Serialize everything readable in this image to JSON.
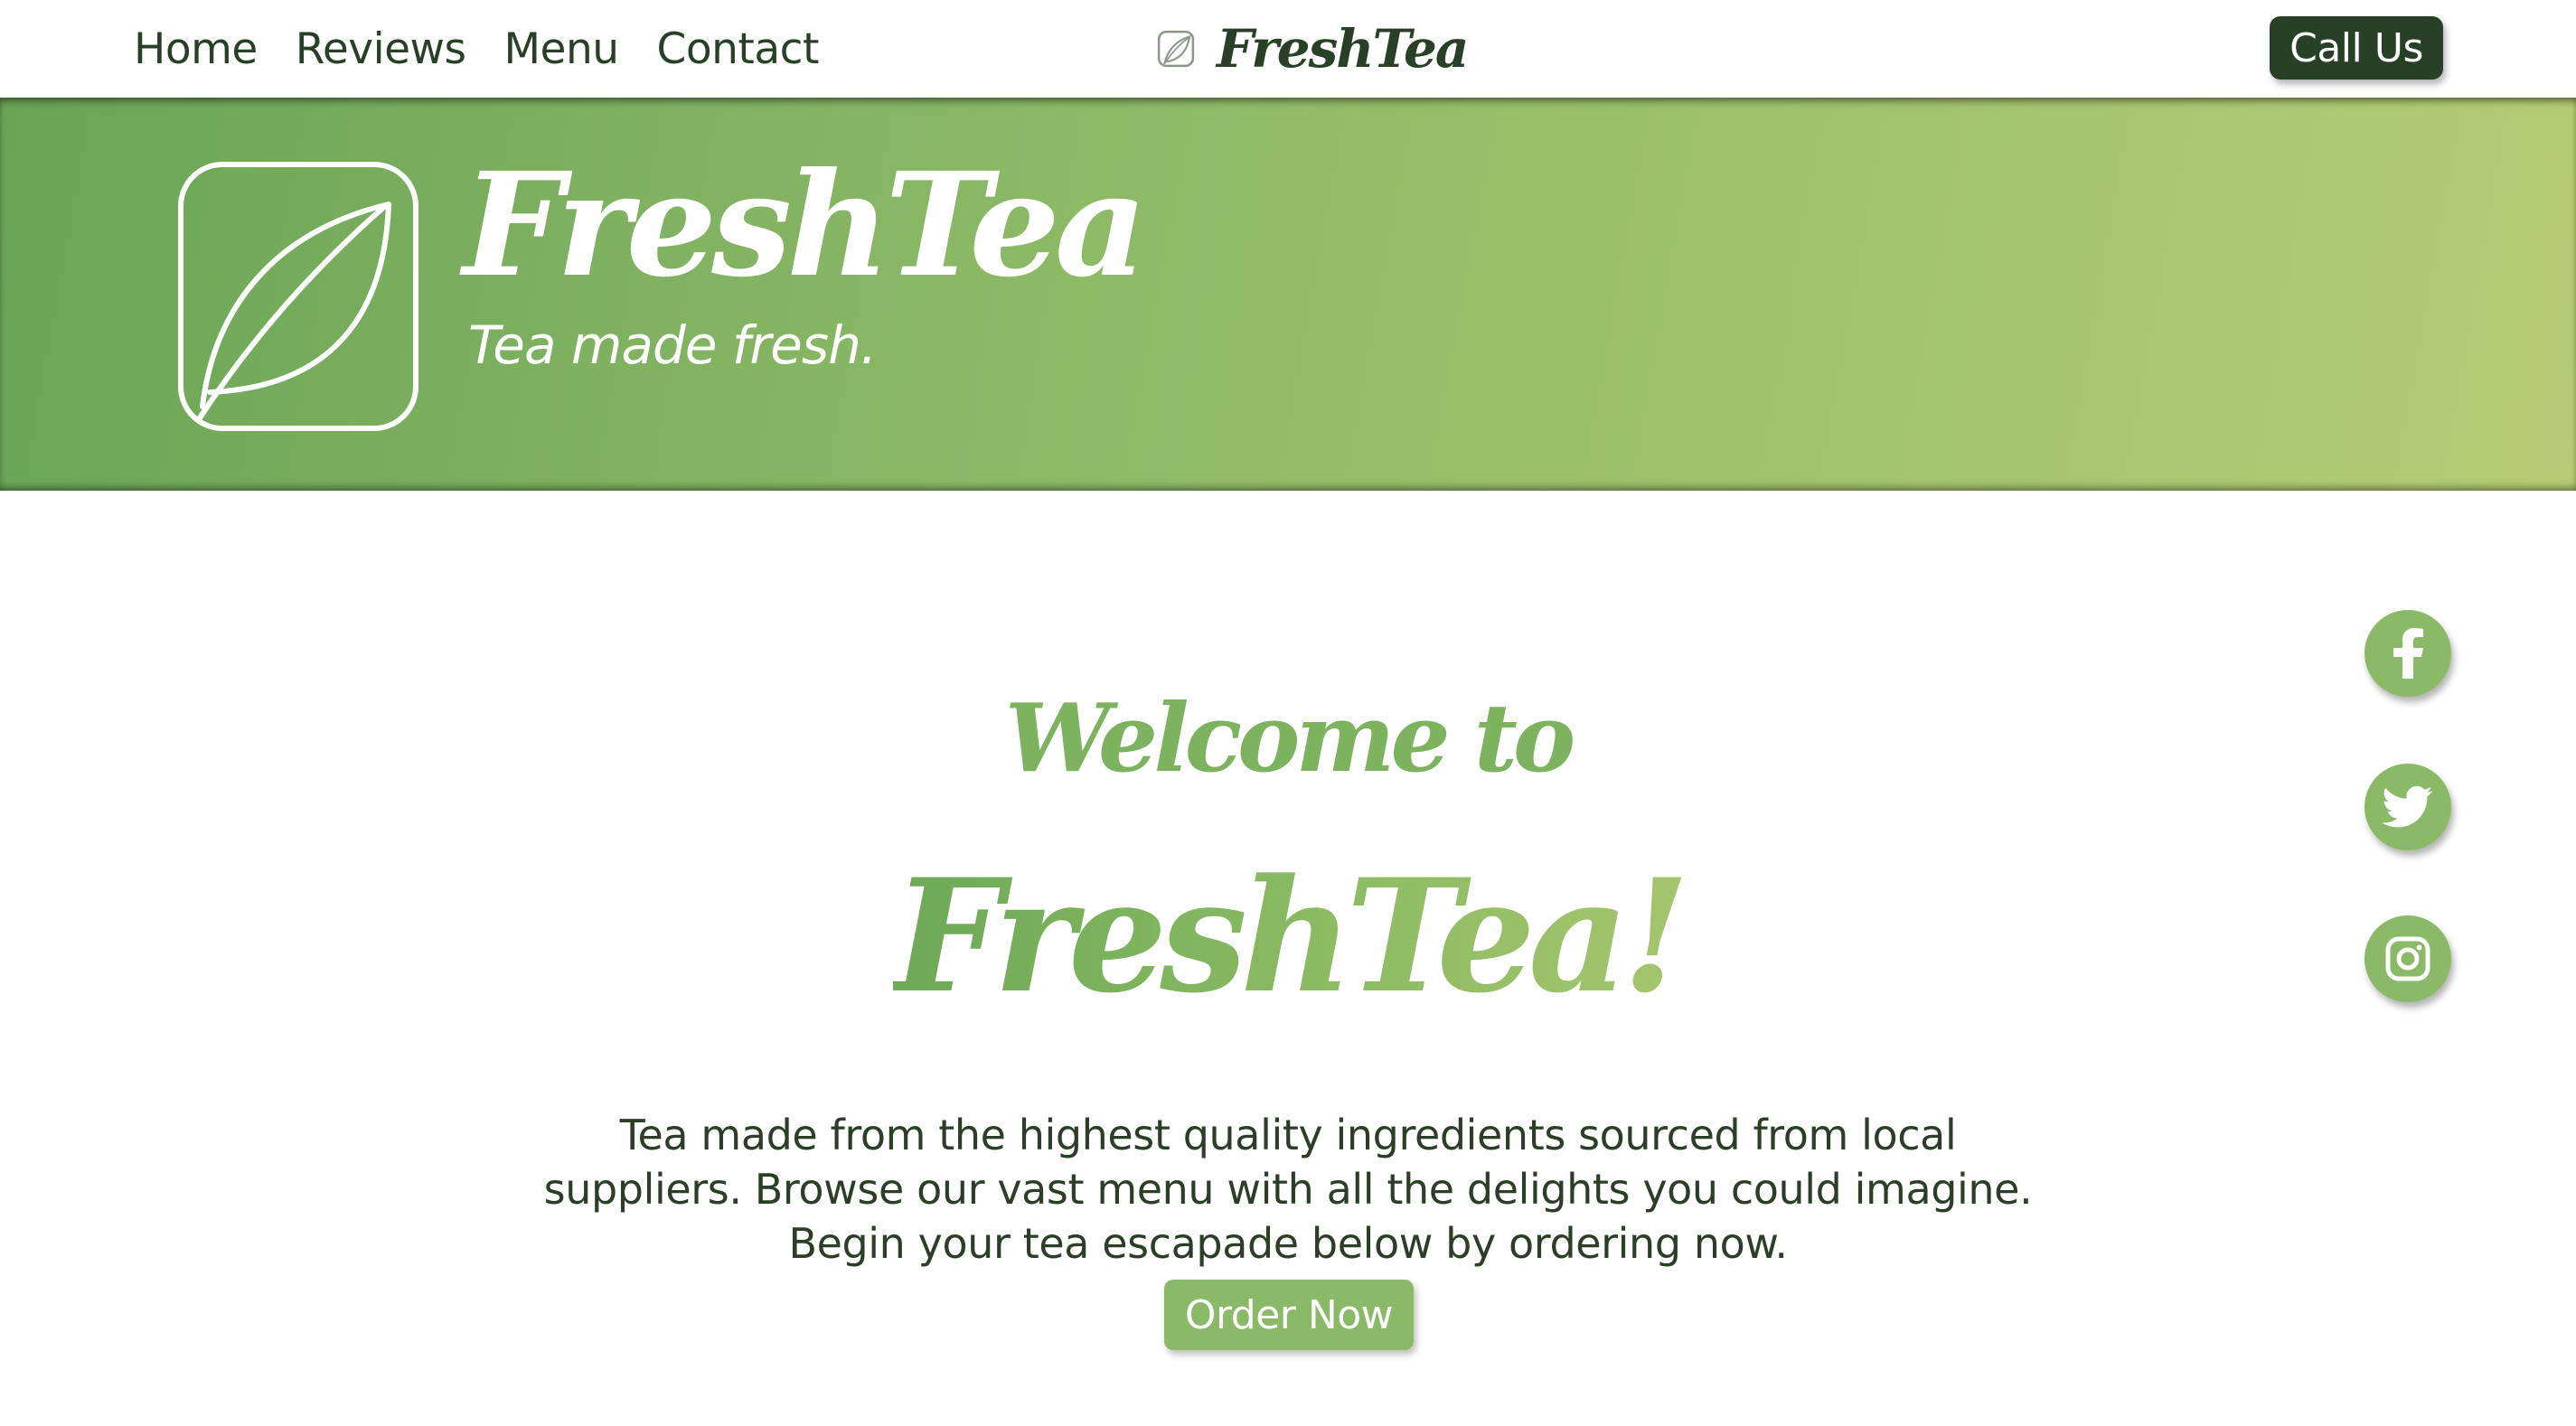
{
  "nav": {
    "links": [
      "Home",
      "Reviews",
      "Menu",
      "Contact"
    ],
    "brand": "FreshTea",
    "call_label": "Call Us"
  },
  "hero": {
    "title": "FreshTea",
    "tagline": "Tea made fresh.",
    "logo_icon": "leaf-icon"
  },
  "main": {
    "welcome": "Welcome to",
    "brand": "FreshTea!",
    "intro": "Tea made from the highest quality ingredients sourced from local suppliers. Browse our vast menu with all the delights you could imagine. Begin your tea escapade below by ordering now.",
    "order_label": "Order Now"
  },
  "social": {
    "items": [
      "facebook-icon",
      "twitter-icon",
      "instagram-icon"
    ]
  },
  "colors": {
    "dark_green": "#284025",
    "accent_green": "#8aba68",
    "hero_gradient_start": "#6aa557",
    "hero_gradient_end": "#b5cd75"
  }
}
